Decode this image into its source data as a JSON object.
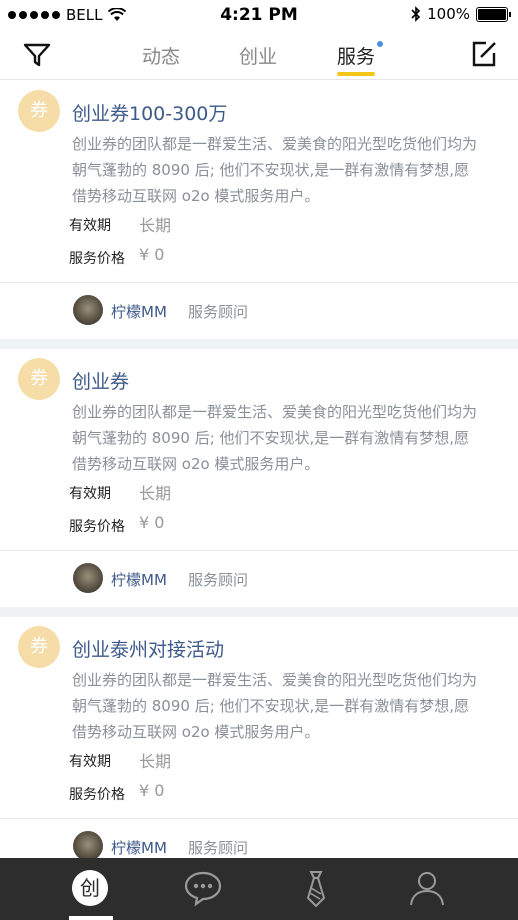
{
  "status": {
    "carrier": "BELL",
    "time": "4:21 PM",
    "battery": "100%"
  },
  "nav": {
    "tabs": [
      {
        "label": "动态",
        "active": false
      },
      {
        "label": "创业",
        "active": false
      },
      {
        "label": "服务",
        "active": true
      }
    ],
    "filter_icon": "filter-icon",
    "compose_icon": "compose-icon"
  },
  "cards": [
    {
      "badge": "券",
      "title": "创业券100-300万",
      "desc": "创业券的团队都是一群爱生活、爱美食的阳光型吃货他们均为朝气蓬勃的 8090 后; 他们不安现状,是一群有激情有梦想,愿借势移动互联网 o2o 模式服务用户。",
      "validity_label": "有效期",
      "validity_value": "长期",
      "price_label": "服务价格",
      "price_value": "¥ 0",
      "author": "柠檬MM",
      "role": "服务顾问"
    },
    {
      "badge": "券",
      "title": "创业券",
      "desc": "创业券的团队都是一群爱生活、爱美食的阳光型吃货他们均为朝气蓬勃的 8090 后; 他们不安现状,是一群有激情有梦想,愿借势移动互联网 o2o 模式服务用户。",
      "validity_label": "有效期",
      "validity_value": "长期",
      "price_label": "服务价格",
      "price_value": "¥ 0",
      "author": "柠檬MM",
      "role": "服务顾问"
    },
    {
      "badge": "券",
      "title": "创业泰州对接活动",
      "desc": "创业券的团队都是一群爱生活、爱美食的阳光型吃货他们均为朝气蓬勃的 8090 后; 他们不安现状,是一群有激情有梦想,愿借势移动互联网 o2o 模式服务用户。",
      "validity_label": "有效期",
      "validity_value": "长期",
      "price_label": "服务价格",
      "price_value": "¥ 0",
      "author": "柠檬MM",
      "role": "服务顾问"
    }
  ],
  "bottom_tabs": [
    {
      "icon": "chuang-icon",
      "active": true
    },
    {
      "icon": "chat-bubble-icon",
      "active": false
    },
    {
      "icon": "tie-icon",
      "active": false
    },
    {
      "icon": "person-icon",
      "active": false
    }
  ]
}
